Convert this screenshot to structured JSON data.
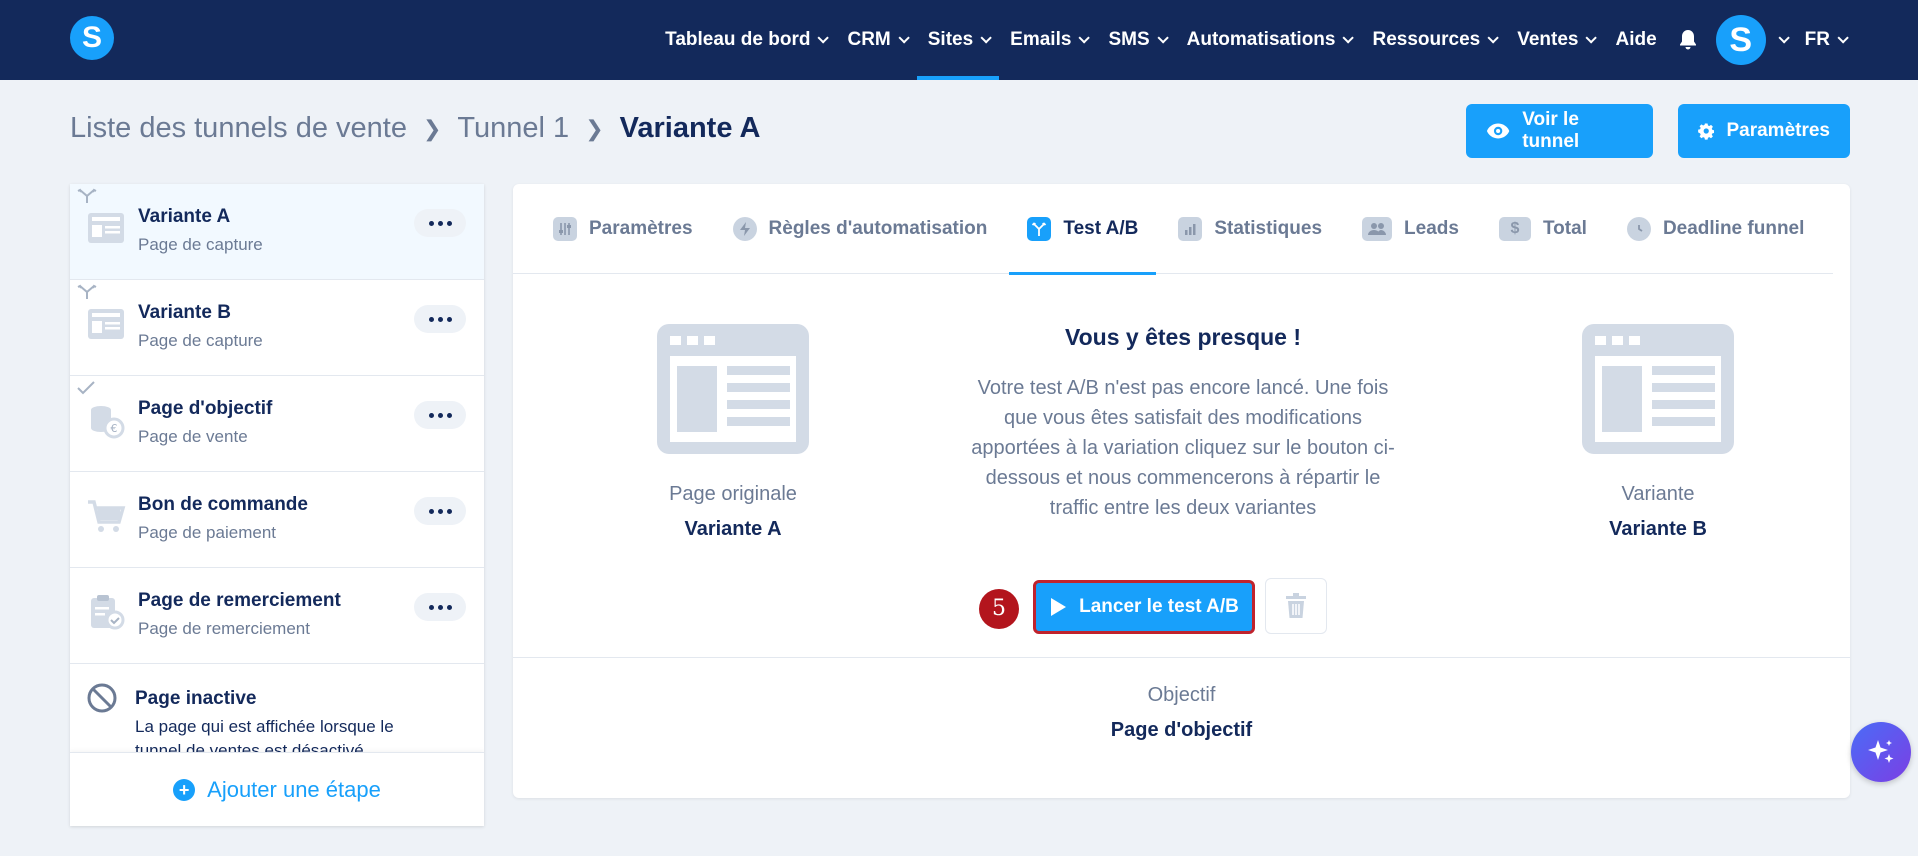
{
  "nav": {
    "logo": "S",
    "items": [
      {
        "label": "Tableau de bord",
        "dropdown": true
      },
      {
        "label": "CRM",
        "dropdown": true
      },
      {
        "label": "Sites",
        "dropdown": true,
        "active": true
      },
      {
        "label": "Emails",
        "dropdown": true
      },
      {
        "label": "SMS",
        "dropdown": true
      },
      {
        "label": "Automatisations",
        "dropdown": true
      },
      {
        "label": "Ressources",
        "dropdown": true
      },
      {
        "label": "Ventes",
        "dropdown": true
      },
      {
        "label": "Aide",
        "dropdown": false
      }
    ],
    "avatar": "S",
    "language": "FR"
  },
  "breadcrumb": {
    "root": "Liste des tunnels de vente",
    "funnel": "Tunnel 1",
    "current": "Variante A"
  },
  "actions": {
    "view_funnel": "Voir le tunnel",
    "settings": "Paramètres"
  },
  "sidebar": {
    "steps": [
      {
        "title": "Variante A",
        "subtitle": "Page de capture"
      },
      {
        "title": "Variante B",
        "subtitle": "Page de capture"
      },
      {
        "title": "Page d'objectif",
        "subtitle": "Page de vente"
      },
      {
        "title": "Bon de commande",
        "subtitle": "Page de paiement"
      },
      {
        "title": "Page de remerciement",
        "subtitle": "Page de remerciement"
      }
    ],
    "inactive": {
      "title": "Page inactive",
      "description": "La page qui est affichée lorsque le tunnel de ventes est désactivé"
    },
    "add_step": "Ajouter une étape"
  },
  "tabs": [
    {
      "label": "Paramètres"
    },
    {
      "label": "Règles d'automatisation"
    },
    {
      "label": "Test A/B",
      "active": true
    },
    {
      "label": "Statistiques"
    },
    {
      "label": "Leads"
    },
    {
      "label": "Total"
    },
    {
      "label": "Deadline funnel"
    }
  ],
  "abtest": {
    "title": "Vous y êtes presque !",
    "description": "Votre test A/B n'est pas encore lancé. Une fois que vous êtes satisfait des modifications apportées à la variation cliquez sur le bouton ci-dessous et nous commencerons à répartir le traffic entre les deux variantes",
    "original_label": "Page originale",
    "original_name": "Variante A",
    "variant_label": "Variante",
    "variant_name": "Variante B",
    "launch_button": "Lancer le test A/B",
    "step_badge": "5",
    "objective_label": "Objectif",
    "objective_name": "Page d'objectif"
  },
  "colors": {
    "nav_bg": "#13295b",
    "accent": "#18a0fb",
    "highlight_border": "#c0232d",
    "badge": "#b3151d"
  }
}
